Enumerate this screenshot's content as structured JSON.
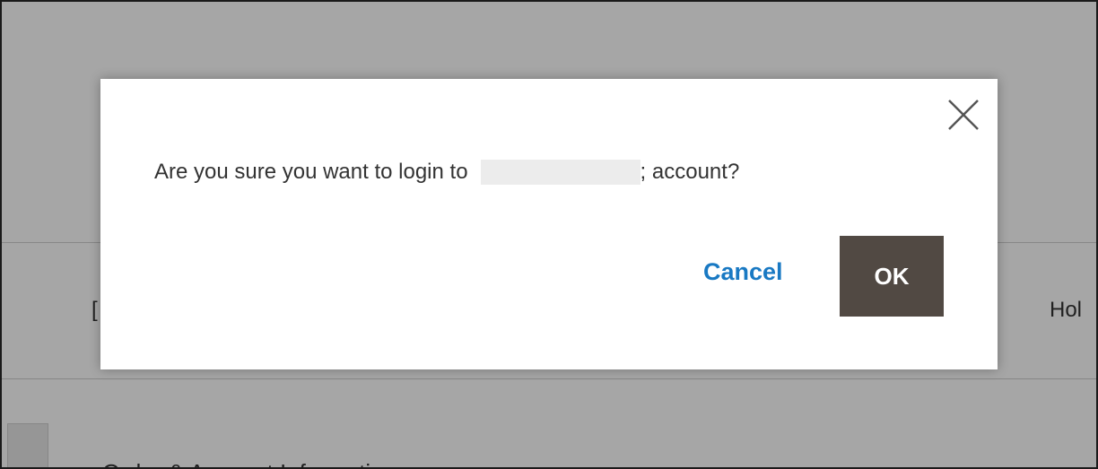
{
  "background": {
    "left_partial_text": "[",
    "right_partial_text": "Hol",
    "bottom_partial_text": "Order & Account Information"
  },
  "modal": {
    "message_prefix": "Are you sure you want to login to",
    "message_suffix": "; account?",
    "cancel_label": "Cancel",
    "ok_label": "OK",
    "close_icon": "close-icon"
  },
  "colors": {
    "accent_link": "#1979c3",
    "primary_button": "#514943",
    "overlay": "rgba(0,0,0,0.35)"
  }
}
